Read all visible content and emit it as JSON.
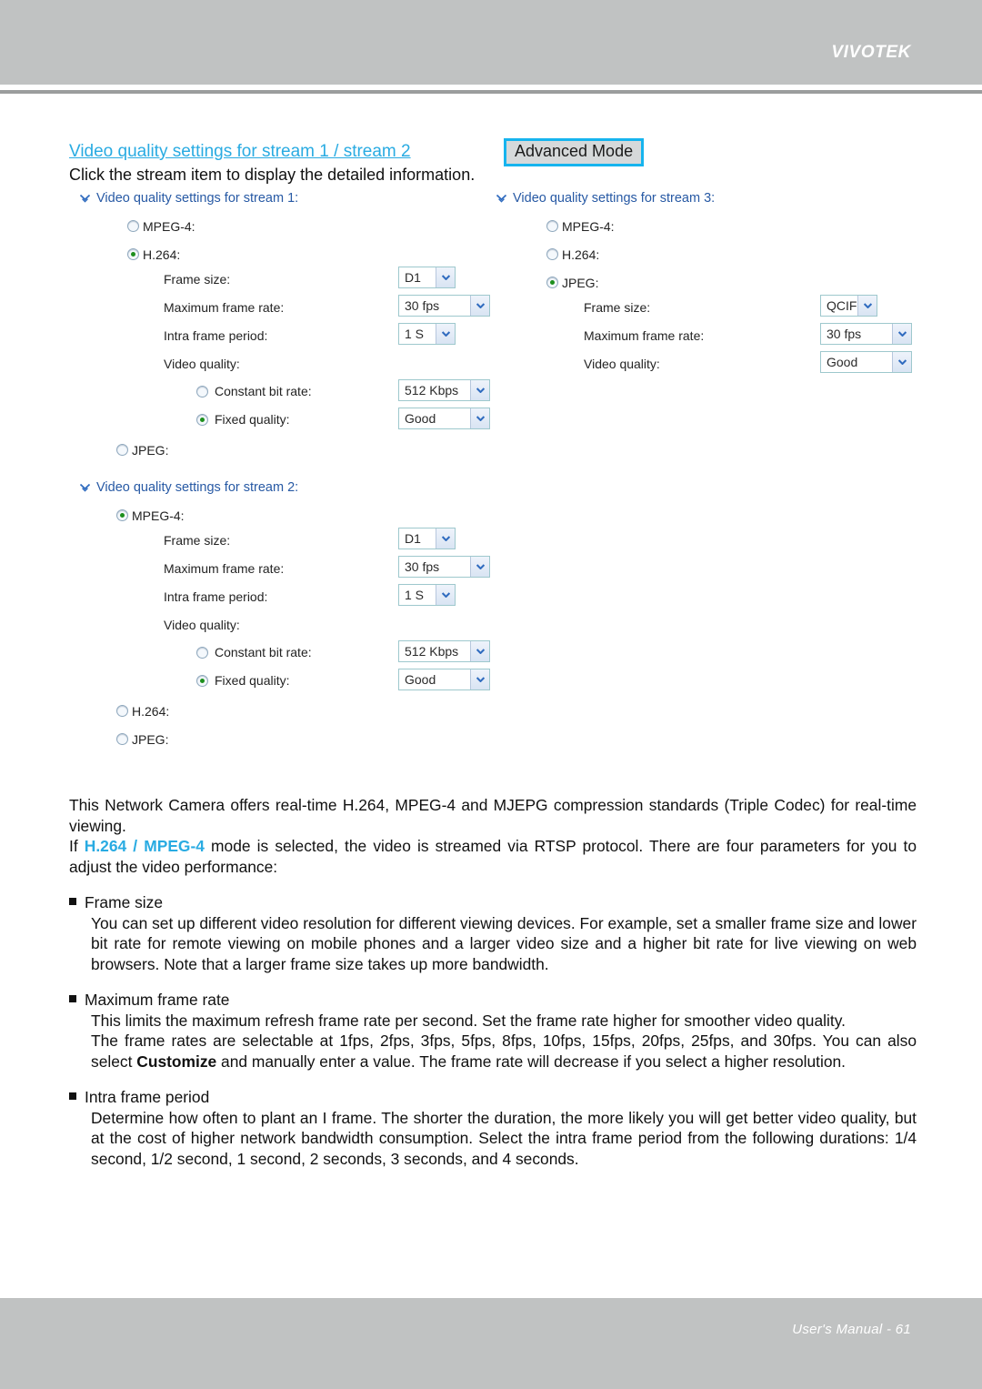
{
  "header": {
    "brand": "VIVOTEK"
  },
  "footer": {
    "text": "User's Manual - 61"
  },
  "title": {
    "link": "Video quality settings for stream 1 / stream 2",
    "advanced_mode_button": "Advanced Mode",
    "subtitle": "Click the stream item to display the detailed information."
  },
  "colors": {
    "link": "#29abe2",
    "section_head": "#2759a4",
    "advanced_border": "#16b4ee",
    "header_bar": "#c0c2c2",
    "radio_checked": "#1d8f1d",
    "dropdown_border": "#9ec8cd"
  },
  "streams": {
    "stream1": {
      "heading": "Video quality settings for stream 1:",
      "codecs": [
        {
          "label": "MPEG-4:",
          "selected": false
        },
        {
          "label": "H.264:",
          "selected": true
        },
        {
          "label": "JPEG:",
          "selected": false
        }
      ],
      "fields": [
        {
          "label": "Frame size:",
          "value": "D1",
          "size": "sm"
        },
        {
          "label": "Maximum frame rate:",
          "value": "30 fps",
          "size": "md"
        },
        {
          "label": "Intra frame period:",
          "value": "1 S",
          "size": "sm"
        }
      ],
      "video_quality_label": "Video quality:",
      "quality_options": [
        {
          "label": "Constant bit rate:",
          "selected": false,
          "value": "512 Kbps",
          "size": "md"
        },
        {
          "label": "Fixed quality:",
          "selected": true,
          "value": "Good",
          "size": "md"
        }
      ]
    },
    "stream2": {
      "heading": "Video quality settings for stream 2:",
      "codecs": [
        {
          "label": "MPEG-4:",
          "selected": true
        },
        {
          "label": "H.264:",
          "selected": false
        },
        {
          "label": "JPEG:",
          "selected": false
        }
      ],
      "fields": [
        {
          "label": "Frame size:",
          "value": "D1",
          "size": "sm"
        },
        {
          "label": "Maximum frame rate:",
          "value": "30 fps",
          "size": "md"
        },
        {
          "label": "Intra frame period:",
          "value": "1 S",
          "size": "sm"
        }
      ],
      "video_quality_label": "Video quality:",
      "quality_options": [
        {
          "label": "Constant bit rate:",
          "selected": false,
          "value": "512 Kbps",
          "size": "md"
        },
        {
          "label": "Fixed quality:",
          "selected": true,
          "value": "Good",
          "size": "md"
        }
      ]
    },
    "stream3": {
      "heading": "Video quality settings for stream 3:",
      "codecs": [
        {
          "label": "MPEG-4:",
          "selected": false
        },
        {
          "label": "H.264:",
          "selected": false
        },
        {
          "label": "JPEG:",
          "selected": true
        }
      ],
      "fields": [
        {
          "label": "Frame size:",
          "value": "QCIF",
          "size": "sm"
        },
        {
          "label": "Maximum frame rate:",
          "value": "30 fps",
          "size": "md"
        },
        {
          "label": "Video quality:",
          "value": "Good",
          "size": "md"
        }
      ]
    }
  },
  "body": {
    "para1_a": "This Network Camera offers real-time H.264, MPEG-4 and MJEPG compression standards (Triple Codec) for real-time viewing.",
    "para2_pre": "If ",
    "para2_hl": "H.264 / MPEG-4",
    "para2_post": " mode is selected, the video is streamed via RTSP protocol. There are four parameters for you to adjust the video performance:",
    "bullets": [
      {
        "title": "Frame size",
        "text": "You can set up different video resolution for different viewing devices. For example, set a smaller frame size and lower bit rate for remote viewing on mobile phones and a larger video size and a higher bit rate for live viewing on web browsers. Note that a larger frame size takes up more bandwidth."
      },
      {
        "title": "Maximum frame rate",
        "text_a": "This limits the maximum refresh frame rate per second. Set the frame rate higher for smoother video quality.",
        "text_b_pre": "The frame rates are selectable at 1fps, 2fps, 3fps, 5fps, 8fps, 10fps, 15fps, 20fps, 25fps, and 30fps. You can also select ",
        "text_b_bold": "Customize",
        "text_b_post": " and manually enter a value. The frame rate will decrease if you select a higher resolution."
      },
      {
        "title": "Intra frame period",
        "text": "Determine how often to plant an I frame. The shorter the duration, the more likely you will get better video quality, but at the cost of higher network bandwidth consumption. Select the intra frame period from the following durations: 1/4 second, 1/2 second, 1 second, 2 seconds, 3 seconds, and 4 seconds."
      }
    ]
  }
}
